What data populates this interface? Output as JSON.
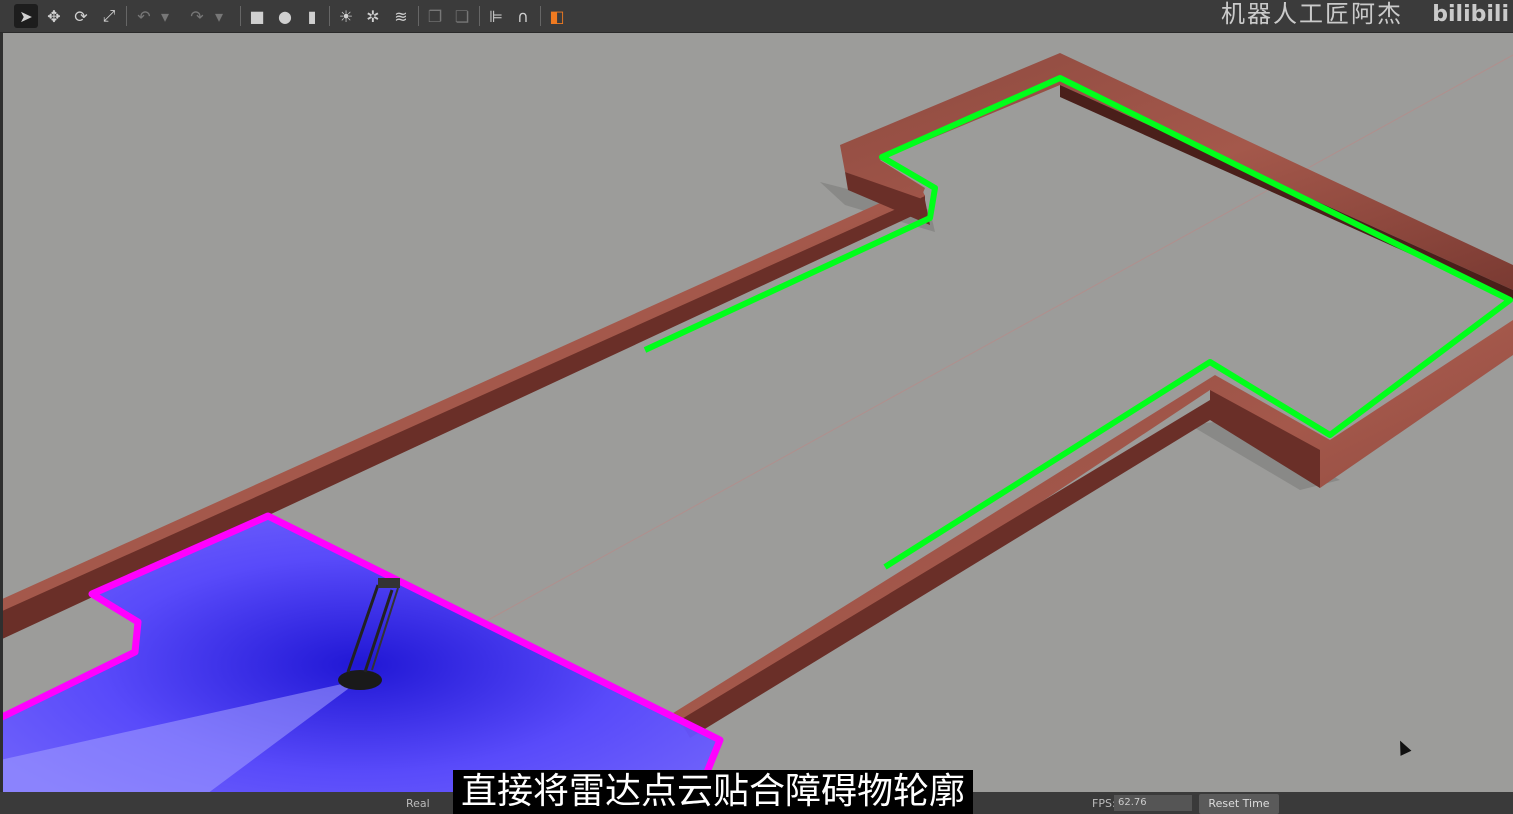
{
  "toolbar": {
    "tools": [
      {
        "name": "select-mode-icon",
        "glyph": "➤"
      },
      {
        "name": "translate-mode-icon",
        "glyph": "✥"
      },
      {
        "name": "rotate-mode-icon",
        "glyph": "⟳"
      },
      {
        "name": "scale-mode-icon",
        "glyph": "⤢"
      },
      {
        "name": "undo-icon",
        "glyph": "↶"
      },
      {
        "name": "undo-dropdown-icon",
        "glyph": "▾"
      },
      {
        "name": "redo-icon",
        "glyph": "↷"
      },
      {
        "name": "redo-dropdown-icon",
        "glyph": "▾"
      },
      {
        "name": "box-shape-icon",
        "glyph": "■"
      },
      {
        "name": "sphere-shape-icon",
        "glyph": "●"
      },
      {
        "name": "cylinder-shape-icon",
        "glyph": "▮"
      },
      {
        "name": "point-light-icon",
        "glyph": "☀"
      },
      {
        "name": "spot-light-icon",
        "glyph": "✲"
      },
      {
        "name": "directional-light-icon",
        "glyph": "≋"
      },
      {
        "name": "copy-icon",
        "glyph": "❐"
      },
      {
        "name": "paste-icon",
        "glyph": "❏"
      },
      {
        "name": "align-icon",
        "glyph": "⊫"
      },
      {
        "name": "snap-icon",
        "glyph": "∩"
      },
      {
        "name": "change-view-icon",
        "glyph": "◧"
      }
    ]
  },
  "watermark": {
    "text": "机器人工匠阿杰",
    "logo": "bilibili"
  },
  "bottom_bar": {
    "real_label": "Real",
    "fps_label": "FPS:",
    "fps_value": "62.76",
    "reset_time": "Reset Time"
  },
  "subtitle": "直接将雷达点云贴合障碍物轮廓",
  "colors": {
    "ground": "#9c9c9a",
    "wall": "#7a3a32",
    "laser_green": "#00ff1a",
    "costmap_magenta": "#ff00ff",
    "scan_blue": "#3a2bff"
  }
}
